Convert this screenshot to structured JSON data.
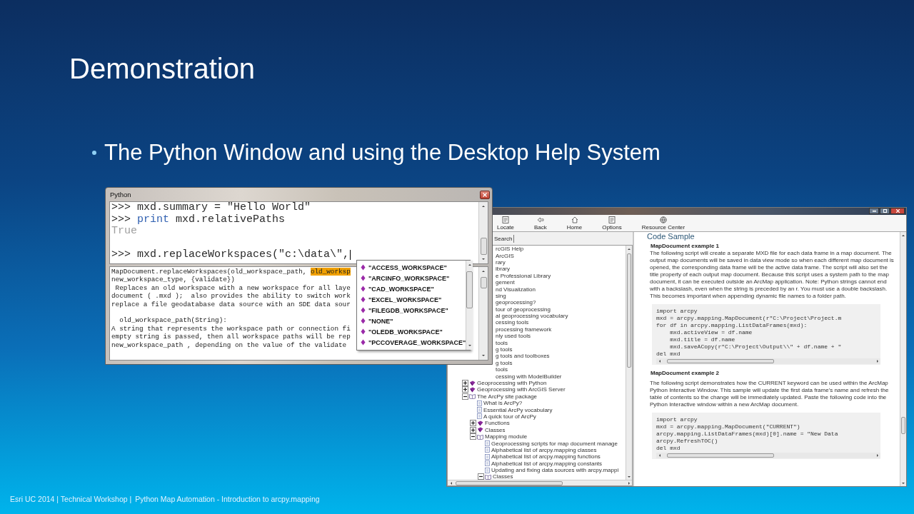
{
  "slide": {
    "title": "Demonstration",
    "bullets": [
      "The Python Window and using the Desktop Help System"
    ],
    "footer": {
      "event": "Esri UC 2014 | Technical Workshop |",
      "session": "Python Map Automation - Introduction to arcpy.mapping"
    }
  },
  "help_window": {
    "toolbar": [
      {
        "label": "Locate",
        "kind": "locate"
      },
      {
        "label": "Back",
        "kind": "back"
      },
      {
        "label": "Home",
        "kind": "home"
      },
      {
        "label": "Options",
        "kind": "options"
      },
      {
        "label": "Resource Center",
        "kind": "resources"
      }
    ],
    "tab": "Search",
    "tree": {
      "partly_hidden_rows": [
        "rcGIS Help",
        "ArcGIS",
        "rary",
        "ibrary",
        "e Professional Library",
        "gement",
        "nd Visualization",
        "sing",
        "geoprocessing?",
        "tour of geoprocessing",
        "al geoprocessing vocabulary",
        "cessing tools",
        "processing framework",
        "nly used tools",
        "tools",
        "g tools",
        "g tools and toolboxes",
        "g tools",
        "tools",
        "cessing with ModelBuilder"
      ],
      "items": [
        {
          "label": "Geoprocessing with Python",
          "kind": "book",
          "expanded": false
        },
        {
          "label": "Geoprocessing with ArcGIS Server",
          "kind": "book",
          "expanded": false
        },
        {
          "label": "The ArcPy site package",
          "kind": "book",
          "expanded": true,
          "children": [
            {
              "label": "What is ArcPy?",
              "kind": "page"
            },
            {
              "label": "Essential ArcPy vocabulary",
              "kind": "page"
            },
            {
              "label": "A quick tour of ArcPy",
              "kind": "page"
            },
            {
              "label": "Functions",
              "kind": "book",
              "expanded": false
            },
            {
              "label": "Classes",
              "kind": "book",
              "expanded": false
            },
            {
              "label": "Mapping module",
              "kind": "book",
              "expanded": true,
              "children": [
                {
                  "label": "Geoprocessing scripts for map document manage",
                  "kind": "page"
                },
                {
                  "label": "Alphabetical list of arcpy.mapping classes",
                  "kind": "page"
                },
                {
                  "label": "Alphabetical list of arcpy.mapping functions",
                  "kind": "page"
                },
                {
                  "label": "Alphabetical list of arcpy.mapping constants",
                  "kind": "page"
                },
                {
                  "label": "Updating and fixing data sources with arcpy.mappi",
                  "kind": "page"
                },
                {
                  "label": "Classes",
                  "kind": "book",
                  "expanded": true
                }
              ]
            }
          ]
        }
      ]
    },
    "content": {
      "heading": "Code Sample",
      "examples": [
        {
          "title": "MapDocument example 1",
          "text": "The following script will create a separate MXD file for each data frame in a map document. The output map documents will be saved in data view mode so when each different map document is opened, the corresponding data frame will be the active data frame. The script will also set the title property of each output map document. Because this script uses a system path to the map document, it can be executed outside an ArcMap application. Note: Python strings cannot end with a backslash, even when the string is preceded by an r. You must use a double backslash. This becomes important when appending dynamic file names to a folder path.",
          "code": [
            "import arcpy",
            "mxd = arcpy.mapping.MapDocument(r\"C:\\Project\\Project.m",
            "for df in arcpy.mapping.ListDataFrames(mxd):",
            "    mxd.activeView = df.name",
            "    mxd.title = df.name",
            "    mxd.saveACopy(r\"C:\\Project\\Output\\\\\" + df.name + \"",
            "del mxd"
          ]
        },
        {
          "title": "MapDocument example 2",
          "text": "The following script demonstrates how the CURRENT keyword can be used within the ArcMap Python Interactive Window. This sample will update the first data frame's name and refresh the table of contents so the change will be immediately updated. Paste the following code into the Python Interactive window within a new ArcMap document.",
          "code": [
            "import arcpy",
            "mxd = arcpy.mapping.MapDocument(\"CURRENT\")",
            "arcpy.mapping.ListDataFrames(mxd)[0].name = \"New Data",
            "arcpy.RefreshTOC()",
            "del mxd"
          ]
        }
      ]
    }
  },
  "python_window": {
    "title": "Python",
    "console": [
      {
        "kind": "input",
        "prompt": ">>>",
        "text": "mxd.summary = \"Hello World\""
      },
      {
        "kind": "input",
        "prompt": ">>>",
        "keyword": "print",
        "text": "mxd.relativePaths"
      },
      {
        "kind": "output",
        "text": "True"
      },
      {
        "kind": "blank"
      },
      {
        "kind": "input",
        "prompt": ">>>",
        "text": "mxd.replaceWorkspaces(\"c:\\data\\\","
      }
    ],
    "doc_paragraphs": [
      [
        {
          "text": "MapDocument.replaceWorkspaces(old_workspace_path, ",
          "highlight": "old_worksp"
        },
        {
          "text": "new_workspace_type, {validate})"
        },
        {
          "text": " Replaces an old workspace with a new workspace for all laye"
        },
        {
          "text": "document ( .mxd );  also provides the ability to switch work"
        },
        {
          "text": "replace a file geodatabase data source with an SDE data sour"
        }
      ],
      [
        {
          "text": "  old_workspace_path(String):"
        },
        {
          "text": "A string that represents the workspace path or connection fi"
        },
        {
          "text": "empty string is passed, then all workspace paths will be rep"
        },
        {
          "text": "new_workspace_path , depending on the value of the validate"
        }
      ]
    ],
    "completions": [
      "\"ACCESS_WORKSPACE\"",
      "\"ARCINFO_WORKSPACE\"",
      "\"CAD_WORKSPACE\"",
      "\"EXCEL_WORKSPACE\"",
      "\"FILEGDB_WORKSPACE\"",
      "\"NONE\"",
      "\"OLEDB_WORKSPACE\"",
      "\"PCCOVERAGE_WORKSPACE\""
    ]
  }
}
